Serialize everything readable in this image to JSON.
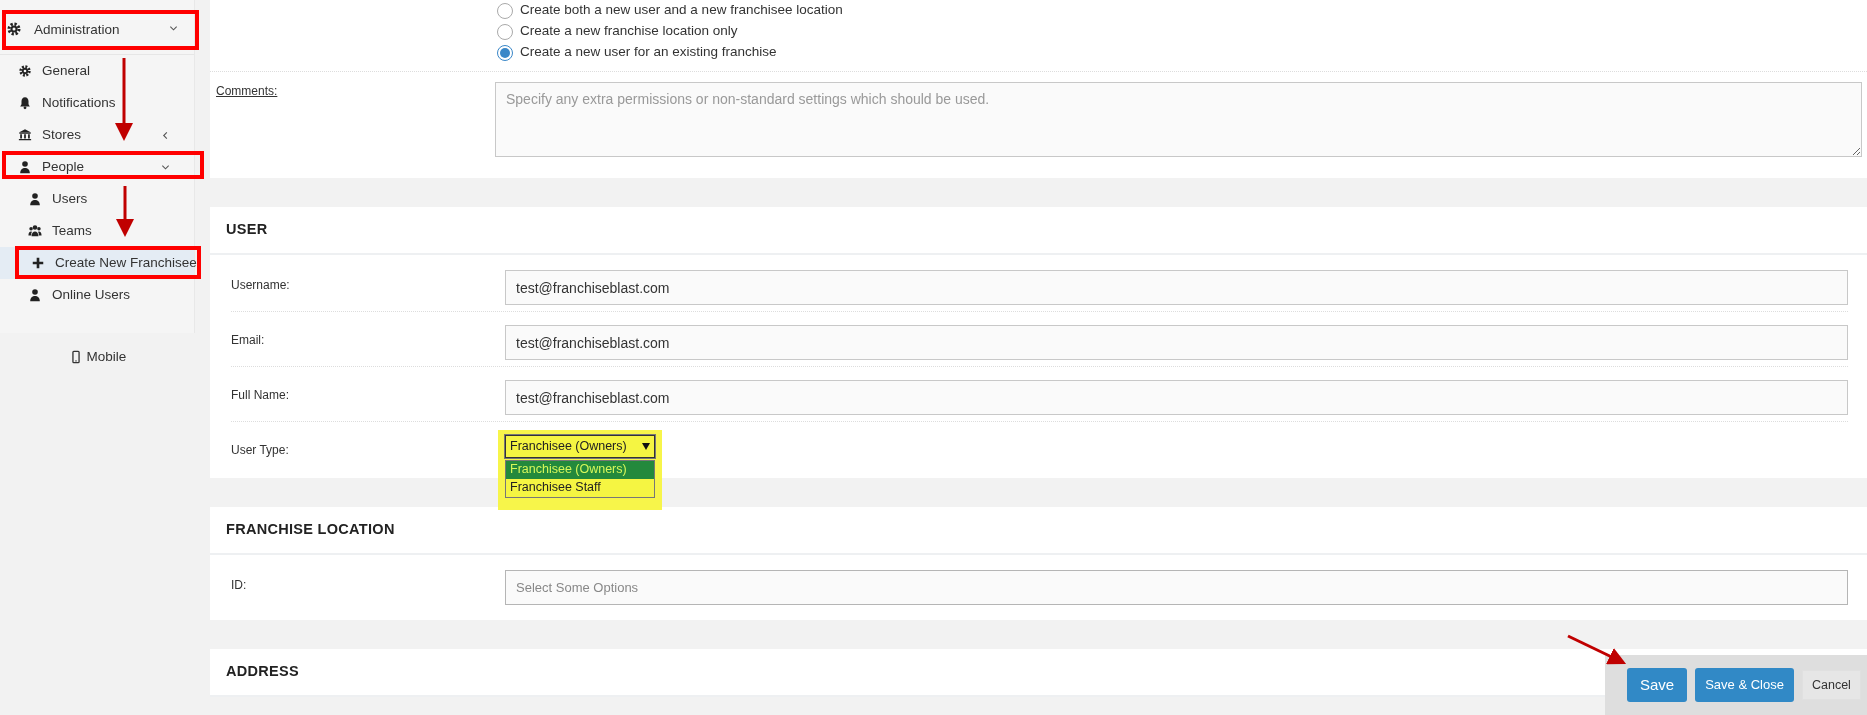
{
  "sidebar": {
    "items": [
      {
        "label": "Administration",
        "expanded": true,
        "children": [
          {
            "label": "General",
            "selected": false
          },
          {
            "label": "Notifications",
            "selected": false
          },
          {
            "label": "Stores",
            "selected": false,
            "expanded": false
          },
          {
            "label": "People",
            "selected": false,
            "expanded": true,
            "children": [
              {
                "label": "Users",
                "selected": false
              },
              {
                "label": "Teams",
                "selected": false
              },
              {
                "label": "Create New Franchisee",
                "selected": true
              },
              {
                "label": "Online Users",
                "selected": false
              }
            ]
          }
        ]
      }
    ],
    "footer_link": "Mobile"
  },
  "creation_options": [
    {
      "label": "Create both a new user and a new franchisee location",
      "selected": false
    },
    {
      "label": "Create a new franchise location only",
      "selected": false
    },
    {
      "label": "Create a new user for an existing franchise",
      "selected": true
    }
  ],
  "comments": {
    "label": "Comments:",
    "placeholder": "Specify any extra permissions or non-standard settings which should be used."
  },
  "sections": [
    {
      "title": "USER",
      "fields": [
        {
          "label": "Username:",
          "kind": "text",
          "value": "test@franchiseblast.com"
        },
        {
          "label": "Email:",
          "kind": "text",
          "value": "test@franchiseblast.com"
        },
        {
          "label": "Full Name:",
          "kind": "text",
          "value": "test@franchiseblast.com"
        },
        {
          "label": "User Type:",
          "kind": "dropdown",
          "value": "Franchisee (Owners)",
          "expanded": true,
          "options": [
            {
              "label": "Franchisee (Owners)",
              "selected": true
            },
            {
              "label": "Franchisee Staff",
              "selected": false
            }
          ]
        }
      ]
    },
    {
      "title": "FRANCHISE LOCATION",
      "fields": [
        {
          "label": "ID:",
          "kind": "multiselect",
          "placeholder": "Select Some Options"
        }
      ]
    },
    {
      "title": "ADDRESS"
    }
  ],
  "actions": [
    {
      "label": "Save",
      "kind": "primary"
    },
    {
      "label": "Save & Close",
      "kind": "primary"
    },
    {
      "label": "Cancel",
      "kind": "secondary"
    }
  ]
}
